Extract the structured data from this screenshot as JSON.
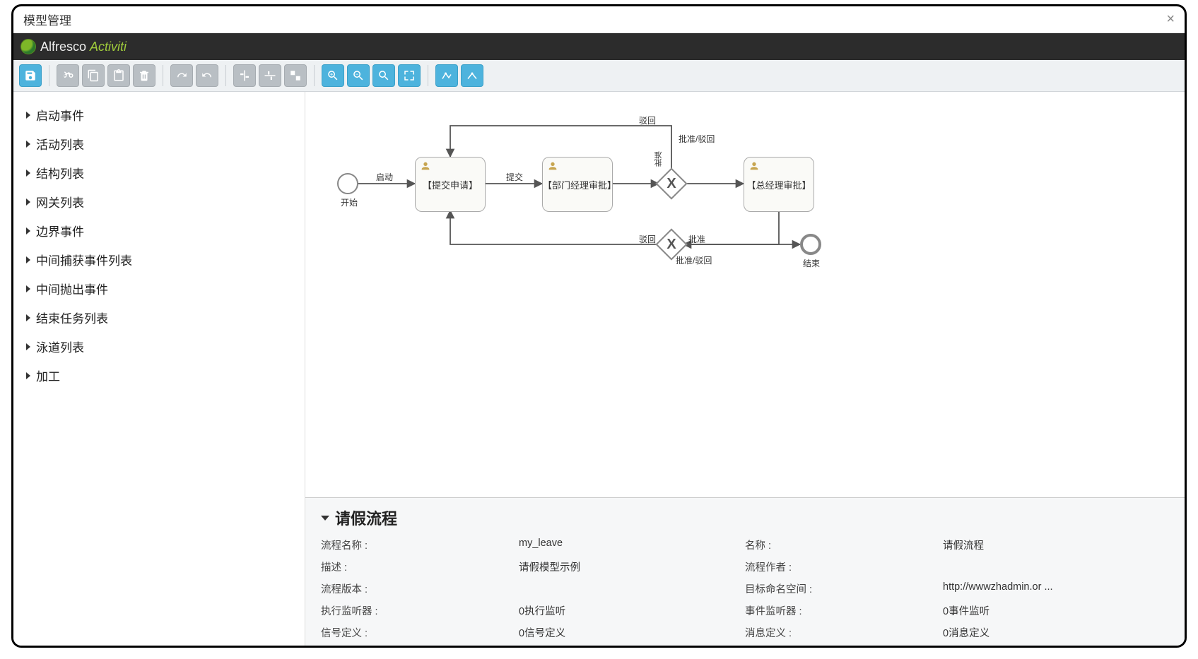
{
  "title": "模型管理",
  "brand": {
    "name1": "Alfresco",
    "name2": "Activiti"
  },
  "sidebar": {
    "items": [
      {
        "label": "启动事件"
      },
      {
        "label": "活动列表"
      },
      {
        "label": "结构列表"
      },
      {
        "label": "网关列表"
      },
      {
        "label": "边界事件"
      },
      {
        "label": "中间捕获事件列表"
      },
      {
        "label": "中间抛出事件"
      },
      {
        "label": "结束任务列表"
      },
      {
        "label": "泳道列表"
      },
      {
        "label": "加工"
      }
    ]
  },
  "diagram": {
    "startLabel": "开始",
    "endLabel": "结束",
    "flowLabels": {
      "start": "启动",
      "submit": "提交",
      "reject1": "驳回",
      "approve1": "批准",
      "gw1": "批准/驳回",
      "reject2": "驳回",
      "approve2": "批准",
      "gw2": "批准/驳回"
    },
    "tasks": {
      "t1": "【提交申请】",
      "t2": "【部门经理审批】",
      "t3": "【总经理审批】"
    }
  },
  "props": {
    "title": "请假流程",
    "rows": [
      {
        "k1": "流程名称 :",
        "v1": "my_leave",
        "k2": "名称 :",
        "v2": "请假流程"
      },
      {
        "k1": "描述 :",
        "v1": "请假模型示例",
        "k2": "流程作者 :",
        "v2": ""
      },
      {
        "k1": "流程版本 :",
        "v1": "",
        "k2": "目标命名空间 :",
        "v2": "http://wwwzhadmin.or ..."
      },
      {
        "k1": "执行监听器 :",
        "v1": "0执行监听",
        "k2": "事件监听器 :",
        "v2": "0事件监听"
      },
      {
        "k1": "信号定义 :",
        "v1": "0信号定义",
        "k2": "消息定义 :",
        "v2": "0消息定义"
      }
    ]
  }
}
